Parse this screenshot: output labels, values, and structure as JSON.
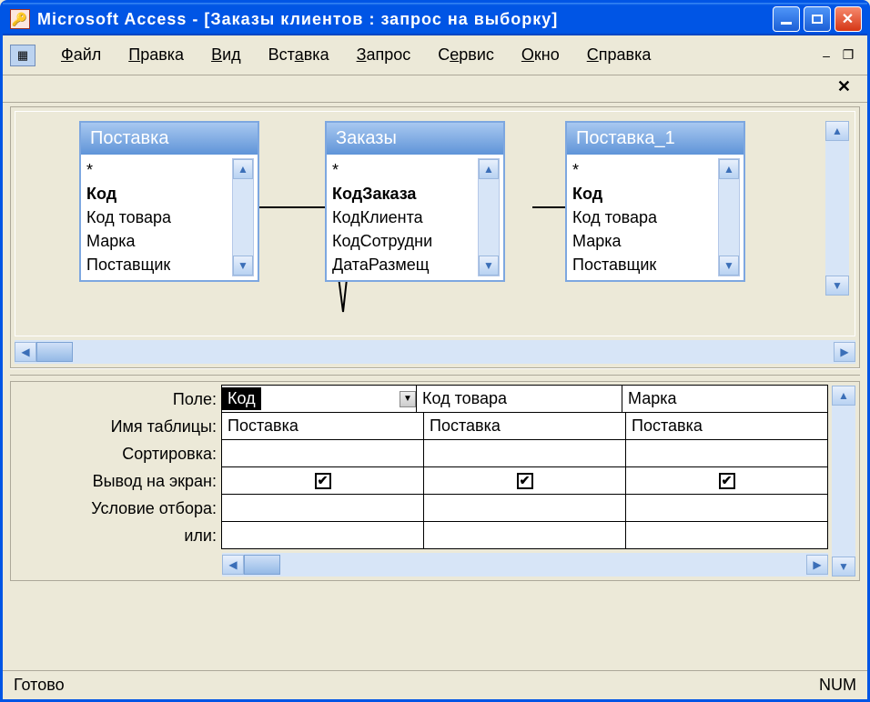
{
  "titlebar": {
    "text": "Microsoft Access - [Заказы клиентов : запрос на выборку]"
  },
  "menu": {
    "items": [
      "Файл",
      "Правка",
      "Вид",
      "Вставка",
      "Запрос",
      "Сервис",
      "Окно",
      "Справка"
    ]
  },
  "tables": [
    {
      "name": "Поставка",
      "fields": [
        "*",
        "Код",
        "Код товара",
        "Марка",
        "Поставщик"
      ],
      "bold_index": 1
    },
    {
      "name": "Заказы",
      "fields": [
        "*",
        "КодЗаказа",
        "КодКлиента",
        "КодСотрудни",
        "ДатаРазмещ"
      ],
      "bold_index": 1
    },
    {
      "name": "Поставка_1",
      "fields": [
        "*",
        "Код",
        "Код товара",
        "Марка",
        "Поставщик"
      ],
      "bold_index": 1
    }
  ],
  "grid": {
    "row_labels": [
      "Поле:",
      "Имя таблицы:",
      "Сортировка:",
      "Вывод на экран:",
      "Условие отбора:",
      "или:"
    ],
    "columns": [
      {
        "field": "Код",
        "table": "Поставка",
        "sort": "",
        "show": true,
        "criteria": "",
        "or": ""
      },
      {
        "field": "Код товара",
        "table": "Поставка",
        "sort": "",
        "show": true,
        "criteria": "",
        "or": ""
      },
      {
        "field": "Марка",
        "table": "Поставка",
        "sort": "",
        "show": true,
        "criteria": "",
        "or": ""
      }
    ]
  },
  "statusbar": {
    "ready": "Готово",
    "num": "NUM"
  }
}
